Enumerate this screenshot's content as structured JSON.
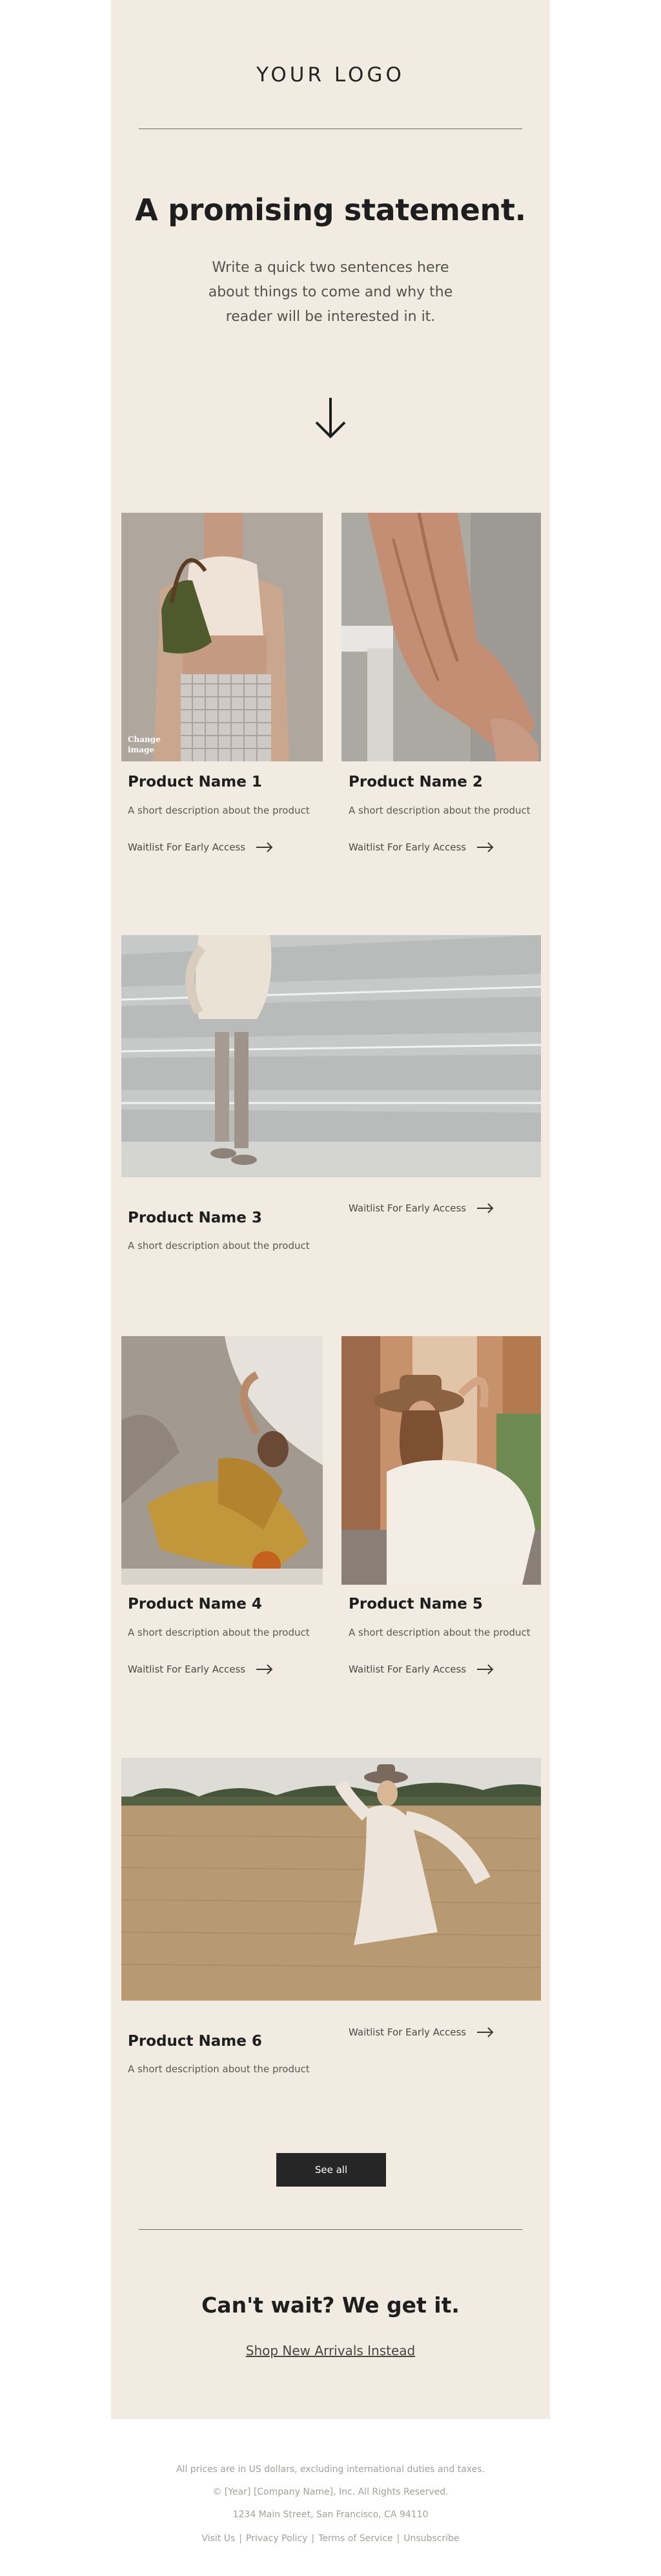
{
  "header": {
    "logo": "YOUR LOGO"
  },
  "hero": {
    "headline": "A promising statement.",
    "intro": "Write a quick two sentences here about things to come and why the reader will be interested in it."
  },
  "image_overlay": "Change image",
  "products": [
    {
      "name": "Product Name 1",
      "desc": "A short description about the product",
      "cta": "Waitlist For Early Access"
    },
    {
      "name": "Product Name 2",
      "desc": "A short description about the product",
      "cta": "Waitlist For Early Access"
    },
    {
      "name": "Product Name 3",
      "desc": "A short description about the product",
      "cta": "Waitlist For Early Access"
    },
    {
      "name": "Product Name 4",
      "desc": "A short description about the product",
      "cta": "Waitlist For Early Access"
    },
    {
      "name": "Product Name 5",
      "desc": "A short description about the product",
      "cta": "Waitlist For Early Access"
    },
    {
      "name": "Product Name 6",
      "desc": "A short description about the product",
      "cta": "Waitlist For Early Access"
    }
  ],
  "see_all": "See all",
  "closing": {
    "headline": "Can't wait? We get it.",
    "link": "Shop New Arrivals Instead"
  },
  "footer": {
    "line1": "All prices are in US dollars, excluding international duties and taxes.",
    "line2": "© [Year] [Company Name], Inc. All Rights Reserved.",
    "line3": "1234 Main Street, San Francisco, CA 94110",
    "links": [
      "Visit Us",
      "Privacy Policy",
      "Terms of Service",
      "Unsubscribe"
    ],
    "separator": "|"
  },
  "colors": {
    "email_bg": "#f1ebe1",
    "button_bg": "#262626",
    "text_dark": "#1e1e1e",
    "footer_text": "#a3a09b"
  },
  "icons": {
    "hero_arrow": "arrow-down-icon",
    "cta_arrow": "arrow-right-icon"
  }
}
